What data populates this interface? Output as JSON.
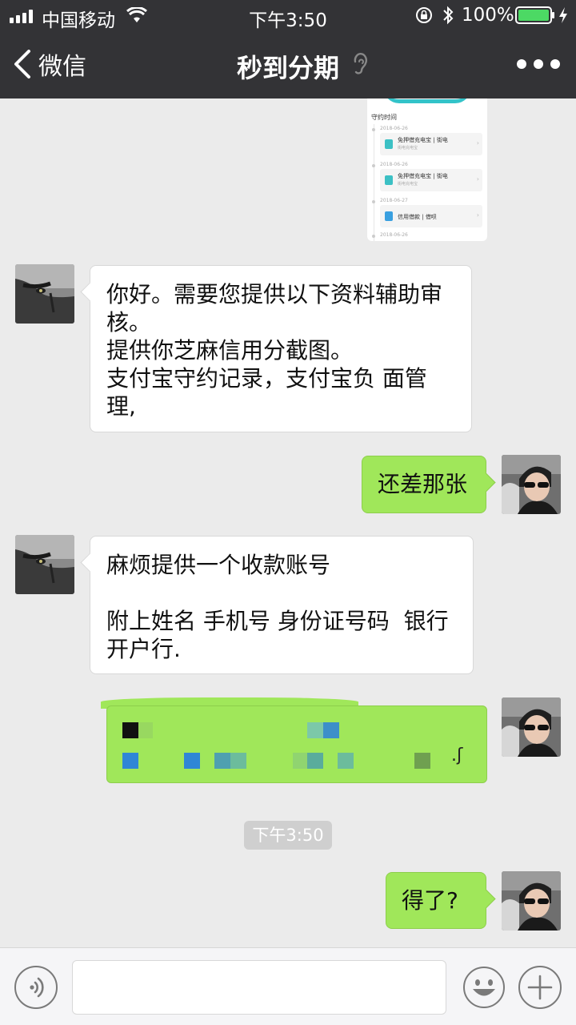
{
  "status_bar": {
    "carrier": "中国移动",
    "time": "下午3:50",
    "battery": "100%"
  },
  "nav": {
    "back_label": "微信",
    "title": "秒到分期",
    "icons": [
      "chevron-left-icon",
      "ear-icon",
      "more-icon"
    ]
  },
  "image_message": {
    "header": "守约时间",
    "entries": [
      {
        "date": "2018-06-26",
        "title": "免押借充电宝",
        "tag": "街电",
        "sub": "街电充电宝"
      },
      {
        "date": "2018-06-26",
        "title": "免押借充电宝",
        "tag": "街电",
        "sub": "街电充电宝"
      },
      {
        "date": "2018-06-27",
        "title": "信用借款",
        "tag": "借呗",
        "sub": ""
      }
    ],
    "last_date": "2018-06-26"
  },
  "messages": [
    {
      "side": "in",
      "text": "你好。需要您提供以下资料辅助审\n核。\n提供你芝麻信用分截图。\n支付宝守约记录，支付宝负 面管\n理,"
    },
    {
      "side": "out",
      "text": "还差那张"
    },
    {
      "side": "in",
      "text": "麻烦提供一个收款账号\n\n附上姓名 手机号 身份证号码  银行\n开户行."
    },
    {
      "side": "out",
      "pixelated_tail": ".ʃ"
    },
    {
      "side": "out",
      "text": "得了?"
    }
  ],
  "time_separator": "下午3:50",
  "input_bar": {
    "placeholder": "",
    "icons": [
      "voice-icon",
      "emoji-icon",
      "plus-icon"
    ]
  },
  "colors": {
    "nav_bg": "#333336",
    "chat_bg": "#ebebeb",
    "out_bubble": "#a0e75a",
    "in_bubble": "#ffffff",
    "battery_green": "#4cd964"
  }
}
